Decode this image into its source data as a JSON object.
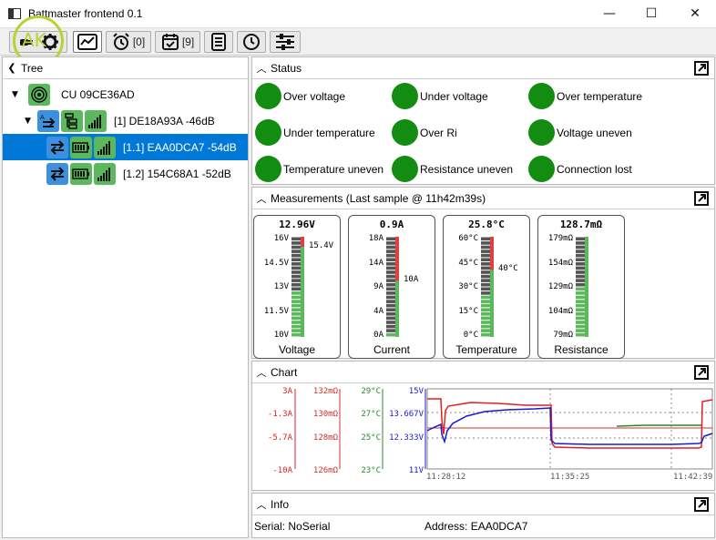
{
  "window": {
    "title": "Battmaster frontend 0.1",
    "minimize": "—",
    "maximize": "☐",
    "close": "✕"
  },
  "toolbar": {
    "alarms_count": "[0]",
    "events_count": "[9]"
  },
  "tree": {
    "title": "Tree",
    "root": "CU 09CE36AD",
    "group": "[1] DE18A93A -46dB",
    "items": [
      {
        "label": "[1.1] EAA0DCA7 -54dB"
      },
      {
        "label": "[1.2] 154C68A1 -52dB"
      }
    ]
  },
  "status": {
    "title": "Status",
    "items": [
      {
        "label": "Over voltage"
      },
      {
        "label": "Under voltage"
      },
      {
        "label": "Over temperature"
      },
      {
        "label": "Under temperature"
      },
      {
        "label": "Over Ri"
      },
      {
        "label": "Voltage uneven"
      },
      {
        "label": "Temperature uneven"
      },
      {
        "label": "Resistance uneven"
      },
      {
        "label": "Connection lost"
      }
    ],
    "ok_color": "#128d12"
  },
  "measurements": {
    "title": "Measurements (Last sample @ 11h42m39s)",
    "gauges": [
      {
        "name": "Voltage",
        "value": "12.96V",
        "ticks": [
          "16V",
          "14.5V",
          "13V",
          "11.5V",
          "10V"
        ],
        "marker": "15.4V",
        "level": 0.49,
        "warn": 0.1,
        "marker_pos": 0.1
      },
      {
        "name": "Current",
        "value": "0.9A",
        "ticks": [
          "18A",
          "14A",
          "9A",
          "4A",
          "0A"
        ],
        "marker": "10A",
        "level": 0.05,
        "warn": 0.44,
        "marker_pos": 0.44
      },
      {
        "name": "Temperature",
        "value": "25.8°C",
        "ticks": [
          "60°C",
          "45°C",
          "30°C",
          "15°C",
          "0°C"
        ],
        "marker": "40°C",
        "level": 0.43,
        "warn": 0.33,
        "marker_pos": 0.33
      },
      {
        "name": "Resistance",
        "value": "128.7mΩ",
        "ticks": [
          "179mΩ",
          "154mΩ",
          "129mΩ",
          "104mΩ",
          "79mΩ"
        ],
        "marker": "",
        "level": 0.5,
        "warn": 0,
        "marker_pos": 0
      }
    ]
  },
  "chart": {
    "title": "Chart",
    "current_ticks": [
      "3A",
      "-1.3A",
      "-5.7A",
      "-10A"
    ],
    "resistance_ticks": [
      "132mΩ",
      "130mΩ",
      "128mΩ",
      "126mΩ"
    ],
    "temperature_ticks": [
      "29°C",
      "27°C",
      "25°C",
      "23°C"
    ],
    "voltage_ticks": [
      "15V",
      "13.667V",
      "12.333V",
      "11V"
    ],
    "time_ticks": [
      "11:28:12",
      "11:35:25",
      "11:42:39"
    ],
    "colors": {
      "current": "#e02020",
      "resistance": "#d03030",
      "temperature": "#2a8a2a",
      "voltage": "#1a1ad0"
    }
  },
  "info": {
    "title": "Info",
    "serial": "Serial: NoSerial",
    "address": "Address: EAA0DCA7"
  }
}
